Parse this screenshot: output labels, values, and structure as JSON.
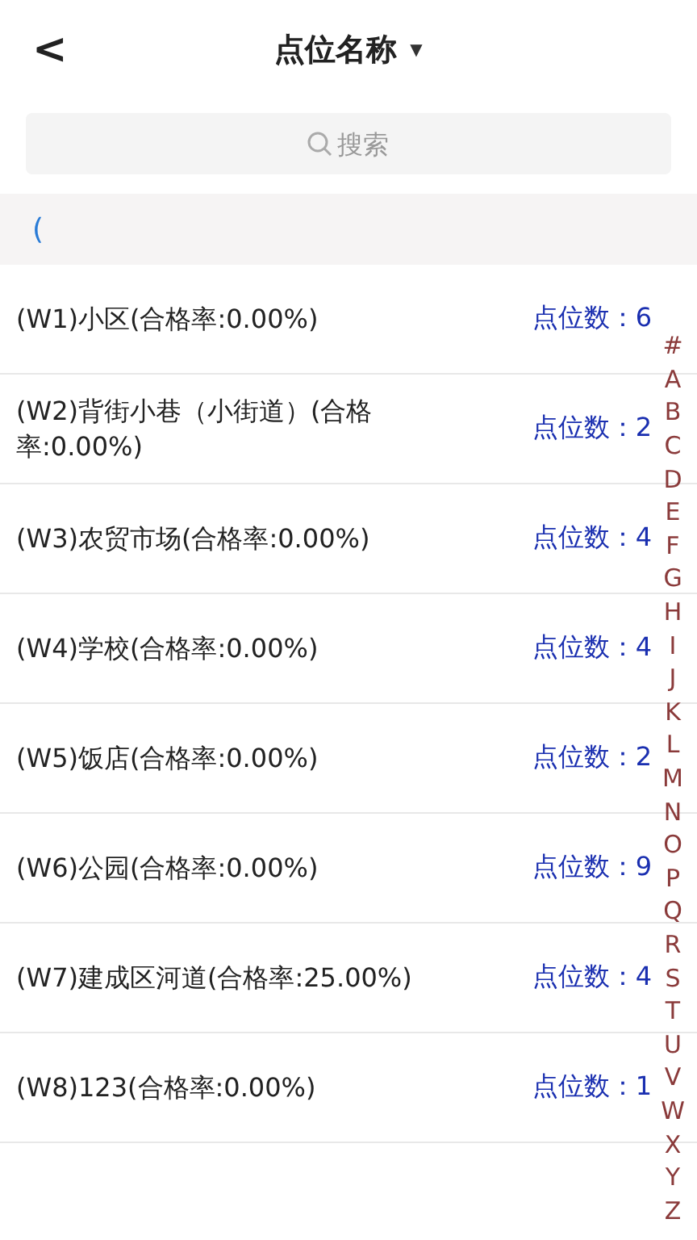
{
  "header": {
    "back": "<",
    "title": "点位名称",
    "dropdown": "▼"
  },
  "search": {
    "placeholder": "搜索"
  },
  "section": {
    "title": "("
  },
  "rows": [
    {
      "name": "(W1)小区(合格率:0.00%)",
      "count_label": "点位数：",
      "count": "6"
    },
    {
      "name": "(W2)背街小巷（小街道）(合格率:0.00%)",
      "count_label": "点位数：",
      "count": "2"
    },
    {
      "name": "(W3)农贸市场(合格率:0.00%)",
      "count_label": "点位数：",
      "count": "4"
    },
    {
      "name": "(W4)学校(合格率:0.00%)",
      "count_label": "点位数：",
      "count": "4"
    },
    {
      "name": "(W5)饭店(合格率:0.00%)",
      "count_label": "点位数：",
      "count": "2"
    },
    {
      "name": "(W6)公园(合格率:0.00%)",
      "count_label": "点位数：",
      "count": "9"
    },
    {
      "name": "(W7)建成区河道(合格率:25.00%)",
      "count_label": "点位数：",
      "count": "4"
    },
    {
      "name": "(W8)123(合格率:0.00%)",
      "count_label": "点位数：",
      "count": "1"
    }
  ],
  "index": [
    "#",
    "A",
    "B",
    "C",
    "D",
    "E",
    "F",
    "G",
    "H",
    "I",
    "J",
    "K",
    "L",
    "M",
    "N",
    "O",
    "P",
    "Q",
    "R",
    "S",
    "T",
    "U",
    "V",
    "W",
    "X",
    "Y",
    "Z"
  ]
}
